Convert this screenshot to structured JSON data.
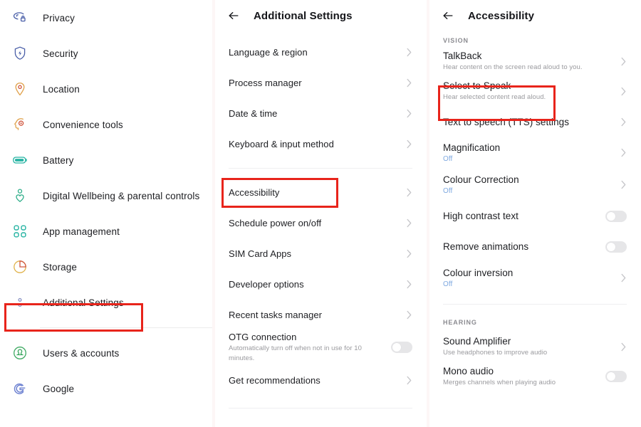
{
  "sidebar": {
    "items": [
      {
        "label": "Privacy",
        "icon": "privacy-icon"
      },
      {
        "label": "Security",
        "icon": "security-shield-icon"
      },
      {
        "label": "Location",
        "icon": "location-pin-icon"
      },
      {
        "label": "Convenience tools",
        "icon": "convenience-tools-icon"
      },
      {
        "label": "Battery",
        "icon": "battery-icon"
      },
      {
        "label": "Digital Wellbeing & parental controls",
        "icon": "digital-wellbeing-icon"
      },
      {
        "label": "App management",
        "icon": "app-management-icon"
      },
      {
        "label": "Storage",
        "icon": "storage-pie-icon"
      },
      {
        "label": "Additional Settings",
        "icon": "additional-settings-icon"
      },
      {
        "label": "Users & accounts",
        "icon": "users-accounts-icon"
      },
      {
        "label": "Google",
        "icon": "google-icon"
      }
    ],
    "highlighted": "Additional Settings"
  },
  "additional_settings": {
    "title": "Additional Settings",
    "back_icon": "back-arrow-icon",
    "items": [
      {
        "label": "Language & region",
        "control": "chevron"
      },
      {
        "label": "Process manager",
        "control": "chevron"
      },
      {
        "label": "Date & time",
        "control": "chevron"
      },
      {
        "label": "Keyboard & input method",
        "control": "chevron"
      },
      {
        "label": "Accessibility",
        "control": "chevron"
      },
      {
        "label": "Schedule power on/off",
        "control": "chevron"
      },
      {
        "label": "SIM Card Apps",
        "control": "chevron"
      },
      {
        "label": "Developer options",
        "control": "chevron"
      },
      {
        "label": "Recent tasks manager",
        "control": "chevron"
      },
      {
        "label": "OTG connection",
        "sub": "Automatically turn off when not in use for 10 minutes.",
        "control": "toggle",
        "toggle_on": false
      },
      {
        "label": "Get recommendations",
        "control": "chevron"
      }
    ],
    "highlighted": "Accessibility"
  },
  "accessibility": {
    "title": "Accessibility",
    "back_icon": "back-arrow-icon",
    "sections": [
      {
        "header": "VISION",
        "items": [
          {
            "label": "TalkBack",
            "sub": "Hear content on the screen read aloud to you.",
            "sub_kind": "desc",
            "control": "chevron"
          },
          {
            "label": "Select to Speak",
            "sub": "Hear selected content read aloud.",
            "sub_kind": "desc",
            "control": "chevron"
          },
          {
            "label": "Text to speech (TTS) settings",
            "control": "chevron"
          },
          {
            "label": "Magnification",
            "sub": "Off",
            "sub_kind": "state",
            "control": "chevron"
          },
          {
            "label": "Colour Correction",
            "sub": "Off",
            "sub_kind": "state",
            "control": "chevron"
          },
          {
            "label": "High contrast text",
            "control": "toggle",
            "toggle_on": false
          },
          {
            "label": "Remove animations",
            "control": "toggle",
            "toggle_on": false
          },
          {
            "label": "Colour inversion",
            "sub": "Off",
            "sub_kind": "state",
            "control": "chevron"
          }
        ]
      },
      {
        "header": "HEARING",
        "items": [
          {
            "label": "Sound Amplifier",
            "sub": "Use headphones to improve audio",
            "sub_kind": "desc",
            "control": "chevron"
          },
          {
            "label": "Mono audio",
            "sub": "Merges channels when playing audio",
            "sub_kind": "desc",
            "control": "toggle",
            "toggle_on": false
          }
        ]
      }
    ],
    "highlighted": "Select to Speak"
  },
  "colors": {
    "highlight_red": "#e8241b",
    "state_blue": "#7fa9e0",
    "page_background": "#fdf6f6"
  }
}
